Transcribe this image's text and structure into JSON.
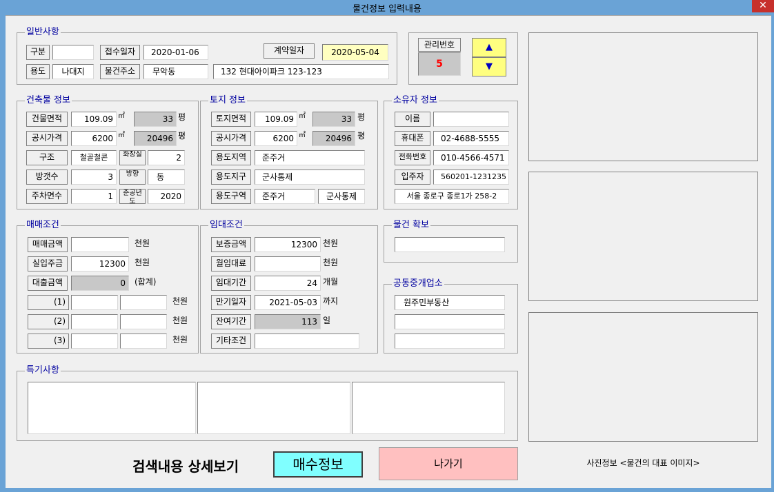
{
  "window": {
    "title": "물건정보 입력내용",
    "close": "✕"
  },
  "general": {
    "legend": "일반사항",
    "gubun_label": "구분",
    "gubun_value": "",
    "receipt_label": "접수일자",
    "receipt_value": "2020-01-06",
    "contract_label": "계약일자",
    "contract_value": "2020-05-04",
    "usage_label": "용도",
    "usage_value": "나대지",
    "address_label": "물건주소",
    "address_dong": "무악동",
    "address_detail": "132 현대아이파크 123-123"
  },
  "mgmt": {
    "label": "관리번호",
    "value": "5",
    "up": "▲",
    "down": "▼"
  },
  "building": {
    "legend": "건축물 정보",
    "area_label": "건물면적",
    "area_value": "109.09",
    "area_unit": "㎡",
    "area_pyeong": "33",
    "pyeong_unit": "평",
    "price_label": "공시가격",
    "price_value": "6200",
    "price_unit": "㎡",
    "price_pyeong": "20496",
    "price_pyeong_unit": "평",
    "structure_label": "구조",
    "structure_value": "철골철콘",
    "bath_label": "화장실",
    "bath_value": "2",
    "rooms_label": "방갯수",
    "rooms_value": "3",
    "direction_label": "방향",
    "direction_value": "동",
    "parking_label": "주차면수",
    "parking_value": "1",
    "built_label": "준공년도",
    "built_value": "2020"
  },
  "land": {
    "legend": "토지 정보",
    "area_label": "토지면적",
    "area_value": "109.09",
    "area_unit": "㎡",
    "area_pyeong": "33",
    "pyeong_unit": "평",
    "price_label": "공시가격",
    "price_value": "6200",
    "price_unit": "㎡",
    "price_pyeong": "20496",
    "price_pyeong_unit": "평",
    "zone_label": "용도지역",
    "zone_value": "준주거",
    "district_label": "용도지구",
    "district_value": "군사통제",
    "area2_label": "용도구역",
    "area2_value1": "준주거",
    "area2_value2": "군사통제"
  },
  "owner": {
    "legend": "소유자 정보",
    "name_label": "이름",
    "name_value": "",
    "mobile_label": "휴대폰",
    "mobile_value": "02-4688-5555",
    "phone_label": "전화번호",
    "phone_value": "010-4566-4571",
    "tenant_label": "입주자",
    "tenant_value": "560201-1231235",
    "address_value": "서울 종로구 종로1가 258-2"
  },
  "sale": {
    "legend": "매매조건",
    "price_label": "매매금액",
    "price_value": "",
    "price_unit": "천원",
    "actual_label": "실입주금",
    "actual_value": "12300",
    "actual_unit": "천원",
    "loan_label": "대출금액",
    "loan_value": "0",
    "loan_unit": "(합계)",
    "loans": [
      {
        "label": "(1)",
        "a": "",
        "b": "",
        "unit": "천원"
      },
      {
        "label": "(2)",
        "a": "",
        "b": "",
        "unit": "천원"
      },
      {
        "label": "(3)",
        "a": "",
        "b": "",
        "unit": "천원"
      }
    ]
  },
  "lease": {
    "legend": "임대조건",
    "deposit_label": "보증금액",
    "deposit_value": "12300",
    "deposit_unit": "천원",
    "monthly_label": "월임대료",
    "monthly_value": "",
    "monthly_unit": "천원",
    "period_label": "임대기간",
    "period_value": "24",
    "period_unit": "개월",
    "expiry_label": "만기일자",
    "expiry_value": "2021-05-03",
    "expiry_unit": "까지",
    "remaining_label": "잔여기간",
    "remaining_value": "113",
    "remaining_unit": "일",
    "other_label": "기타조건",
    "other_value": ""
  },
  "secure": {
    "legend": "물건 확보",
    "value": ""
  },
  "broker": {
    "legend": "공동중개업소",
    "values": [
      "원주민부동산",
      "",
      ""
    ]
  },
  "notes": {
    "legend": "특기사항",
    "values": [
      "",
      "",
      ""
    ]
  },
  "footer": {
    "search_detail": "검색내용 상세보기",
    "buyer_button": "매수정보",
    "exit_button": "나가기",
    "photo_info": "사진정보 <물건의 대표 이미지>"
  },
  "colors": {
    "titlebar": "#6aa3d6",
    "close": "#c7302b",
    "legend": "#0000a0",
    "buyer": "#80ffff",
    "exit": "#ffc0c0",
    "mgmt_value": "#ff0000",
    "yellow_button": "#ffff80"
  }
}
